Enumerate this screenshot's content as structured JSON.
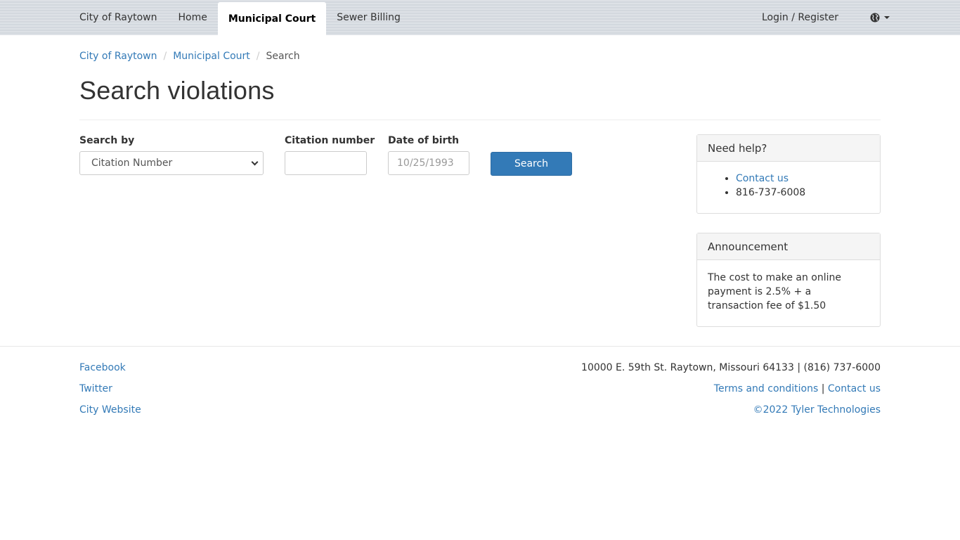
{
  "nav": {
    "items": [
      {
        "label": "City of Raytown"
      },
      {
        "label": "Home"
      },
      {
        "label": "Municipal Court"
      },
      {
        "label": "Sewer Billing"
      }
    ],
    "active_item": "Municipal Court",
    "login_label": "Login / Register",
    "language_icon": "globe-icon"
  },
  "breadcrumb": {
    "items": [
      "City of Raytown",
      "Municipal Court"
    ],
    "current": "Search",
    "separator": "/"
  },
  "page": {
    "title": "Search violations"
  },
  "form": {
    "search_by_label": "Search by",
    "search_by_value": "Citation Number",
    "citation_label": "Citation number",
    "citation_value": "",
    "dob_label": "Date of birth",
    "dob_placeholder": "10/25/1993",
    "search_button": "Search"
  },
  "help_panel": {
    "title": "Need help?",
    "contact_link": "Contact us",
    "phone": "816-737-6008"
  },
  "announcement_panel": {
    "title": "Announcement",
    "text": "The cost to make an online payment is 2.5% + a transaction fee of $1.50"
  },
  "footer": {
    "links": [
      "Facebook",
      "Twitter",
      "City Website"
    ],
    "address": "10000 E. 59th St. Raytown, Missouri 64133 | (816) 737-6000",
    "terms": "Terms and conditions",
    "divider": "|",
    "contact": "Contact us",
    "copyright": "©2022 Tyler Technologies"
  },
  "colors": {
    "link": "#337ab7",
    "primary_button": "#337ab7",
    "navbar": "#d8dde3"
  }
}
